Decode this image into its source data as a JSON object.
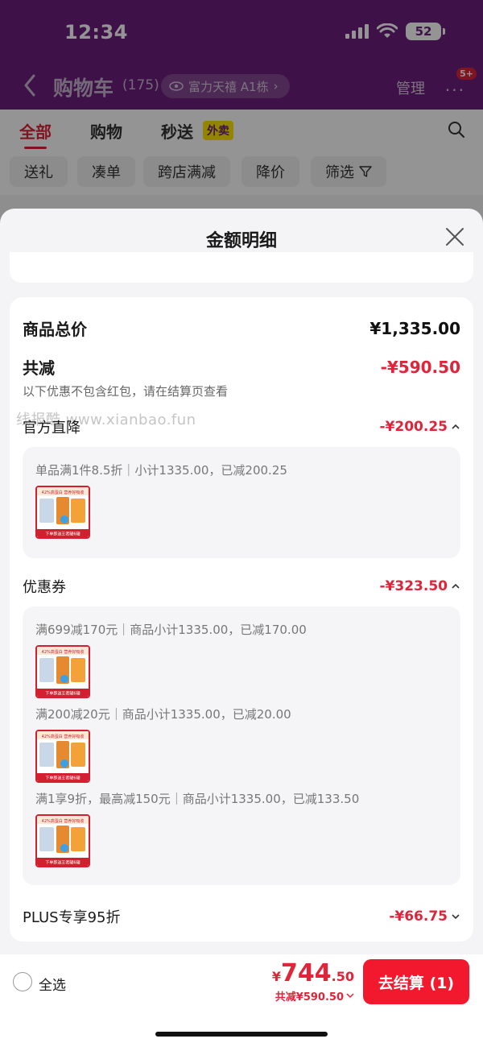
{
  "status_bar": {
    "time": "12:34",
    "battery": "52"
  },
  "cart_header": {
    "title": "购物车",
    "count": "(175)",
    "address": "富力天禧 A1栋",
    "manage": "管理",
    "badge": "5+"
  },
  "tabs": [
    {
      "label": "全部"
    },
    {
      "label": "购物"
    },
    {
      "label": "秒送"
    }
  ],
  "waimai_badge": "外卖",
  "filters": [
    {
      "label": "送礼"
    },
    {
      "label": "凑单"
    },
    {
      "label": "跨店满减"
    },
    {
      "label": "降价"
    },
    {
      "label": "筛选"
    }
  ],
  "sheet": {
    "title": "金额明细",
    "watermark": "线报酷 www.xianbao.fun",
    "goods_total": {
      "label": "商品总价",
      "amount": "¥1,335.00"
    },
    "reduce": {
      "label": "共减",
      "amount": "-¥590.50",
      "note": "以下优惠不包含红包，请在结算页查看"
    },
    "official": {
      "label": "官方直降",
      "amount": "-¥200.25",
      "detail": "单品满1件8.5折｜小计1335.00，已减200.25"
    },
    "coupon": {
      "label": "优惠券",
      "amount": "-¥323.50",
      "details": [
        "满699减170元｜商品小计1335.00，已减170.00",
        "满200减20元｜商品小计1335.00，已减20.00",
        "满1享9折，最高减150元｜商品小计1335.00，已减133.50"
      ]
    },
    "plus": {
      "label": "PLUS专享95折",
      "amount": "-¥66.75"
    },
    "thumb_text": {
      "top": "42%高蛋白 营养好吸收",
      "bottom": "下单即送王者罐6罐"
    }
  },
  "bottom_bar": {
    "select_all": "全选",
    "currency": "¥",
    "total_int": "744",
    "total_dec": ".50",
    "saved": "共减¥590.50",
    "checkout": "去结算 (1)"
  },
  "colors": {
    "brand_purple": "#6b1f7c",
    "accent_red": "#e0243a",
    "button_red": "#f2182e"
  }
}
